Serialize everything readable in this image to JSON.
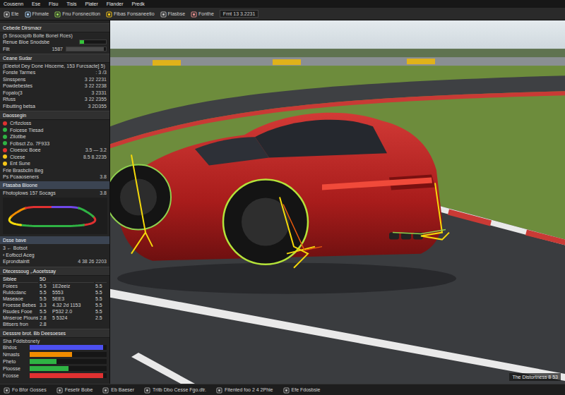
{
  "menu": [
    "Cousenn",
    "Ese",
    "Flsu",
    "Tisis",
    "Plater",
    "Flander",
    "Predk"
  ],
  "toolbar": {
    "buttons": [
      "Ete",
      "Fhmate",
      "Fnu Fonsnecition",
      "Fibas Fonsaneetio",
      "Flasbse",
      "Fonthe"
    ],
    "field": "Frnt  13 3.2231"
  },
  "panel": {
    "rows": [
      {
        "kind": "header",
        "text": "Cebede Dlrsrnacr"
      },
      {
        "kind": "sub",
        "text": "(5 Snsocsptb Bolte Bonel Rces)"
      },
      {
        "kind": "bar",
        "text": "Renue Bloe Snodsbe",
        "level": 0.18,
        "color": "#35c43a"
      },
      {
        "kind": "bar",
        "text": "Fllt",
        "value": "1587",
        "level": 0.95,
        "color": "#4a4a4a"
      },
      {
        "kind": "header",
        "text": "Ceane Sudar"
      },
      {
        "kind": "sub",
        "text": "(Eleetot Dey Done Hisceme, 153 Furcsacte] 5)"
      },
      {
        "kind": "kv",
        "text": "Fonste Tarmes",
        "value": ": 3 /3"
      },
      {
        "kind": "kv",
        "text": "Sinsspens",
        "value": "3  22 2231"
      },
      {
        "kind": "kv",
        "text": "Powdebestes",
        "value": "3  22 2238"
      },
      {
        "kind": "kv",
        "text": "Fopalo(3",
        "value": "3  2331"
      },
      {
        "kind": "kv",
        "text": "Rfuss",
        "value": "3  22 2355"
      },
      {
        "kind": "kv",
        "text": "Fibutting betsa",
        "value": "3  2D355"
      },
      {
        "kind": "header",
        "text": "Daossegin"
      },
      {
        "kind": "dot",
        "text": "Crfizcloss",
        "color": "#e03131"
      },
      {
        "kind": "dot",
        "text": "Foicese Tlesad",
        "color": "#2fb344"
      },
      {
        "kind": "dot",
        "text": "Zllotlbe",
        "color": "#2fb344"
      },
      {
        "kind": "dot",
        "text": "Fcibsct Zo. 7F933",
        "color": "#2fb344"
      },
      {
        "kind": "dot",
        "text": "Cioesoc Boee",
        "value": "3.5 — 3.2",
        "color": "#e03131"
      },
      {
        "kind": "dot",
        "text": "Cicese",
        "value": "8.5  8.2235",
        "color": "#f5c518"
      },
      {
        "kind": "dot",
        "text": "Ent Sune",
        "color": "#f5c518"
      },
      {
        "kind": "kv",
        "text": "Frie Brasbclin Beg"
      },
      {
        "kind": "kv",
        "text": "Ps Pcaaoseners",
        "value": "3.8"
      },
      {
        "kind": "section",
        "text": "Ftasaba Bloone"
      },
      {
        "kind": "kv",
        "text": "Fhotoplows 157 Socags",
        "value": "3.8"
      },
      {
        "kind": "map",
        "segments": [
          "#e03131",
          "#2fb344",
          "#2fb344",
          "#f5d90a",
          "#f08c00",
          "#e03131",
          "#7048e8",
          "#2fb344"
        ]
      },
      {
        "kind": "section",
        "text": "Dsse bave"
      },
      {
        "kind": "kv",
        "text": "3   ← Botsot"
      },
      {
        "kind": "kv",
        "text": "‹ Eofbccl Aceg"
      },
      {
        "kind": "kv",
        "text": "Eprondtalntt",
        "value": "4 38 26 2203"
      },
      {
        "kind": "header",
        "text": "Dtecessoug ,.Aocetssay"
      },
      {
        "kind": "table",
        "columns": [
          "Siblee",
          "5D"
        ],
        "rows": [
          [
            "Foiees",
            "5.5",
            "1E2eeiz",
            "5.5"
          ],
          [
            "Ruldcdanc",
            "5.5",
            "5553",
            "5.5"
          ],
          [
            "Maseaoe",
            "5.5",
            "5EE3",
            "5.5"
          ],
          [
            "Froesse Bebes",
            "3.3",
            "4.32 2d 1153",
            "5.5"
          ],
          [
            "Rsudes Fooe",
            "5.5",
            "P532 2.0",
            "5.5"
          ],
          [
            "Mnseroe Plouns",
            "2.8",
            "5 5324",
            "2.5"
          ],
          [
            "Bttsers fron",
            "2.8"
          ]
        ]
      },
      {
        "kind": "header",
        "text": "Desssre brot. Bb Deesoeses"
      },
      {
        "kind": "sub",
        "text": "Sha Fddlsbsnety"
      },
      {
        "kind": "meters",
        "items": [
          {
            "label": "Bhdos",
            "level": 0.95,
            "color": "#4c4ff0"
          },
          {
            "label": "Nmasts",
            "level": 0.55,
            "color": "#f08c00"
          },
          {
            "label": "Pheto",
            "level": 0.35,
            "color": "#2fb344"
          },
          {
            "label": "Ploosse",
            "level": 0.5,
            "color": "#2fb344"
          },
          {
            "label": "Fcosse",
            "level": 0.95,
            "color": "#e03131"
          }
        ]
      }
    ]
  },
  "viewport": {
    "overlay": "The Distortness 8  53"
  },
  "status_bar": [
    "Fo Bfor Gosses",
    "Fesetir Bobe",
    "Eb Baeser",
    "Tritb Dbo Cesse Fgo.dtr.",
    "Fitented foo 2 4 2Phie",
    "Efe Fdosbsie"
  ]
}
